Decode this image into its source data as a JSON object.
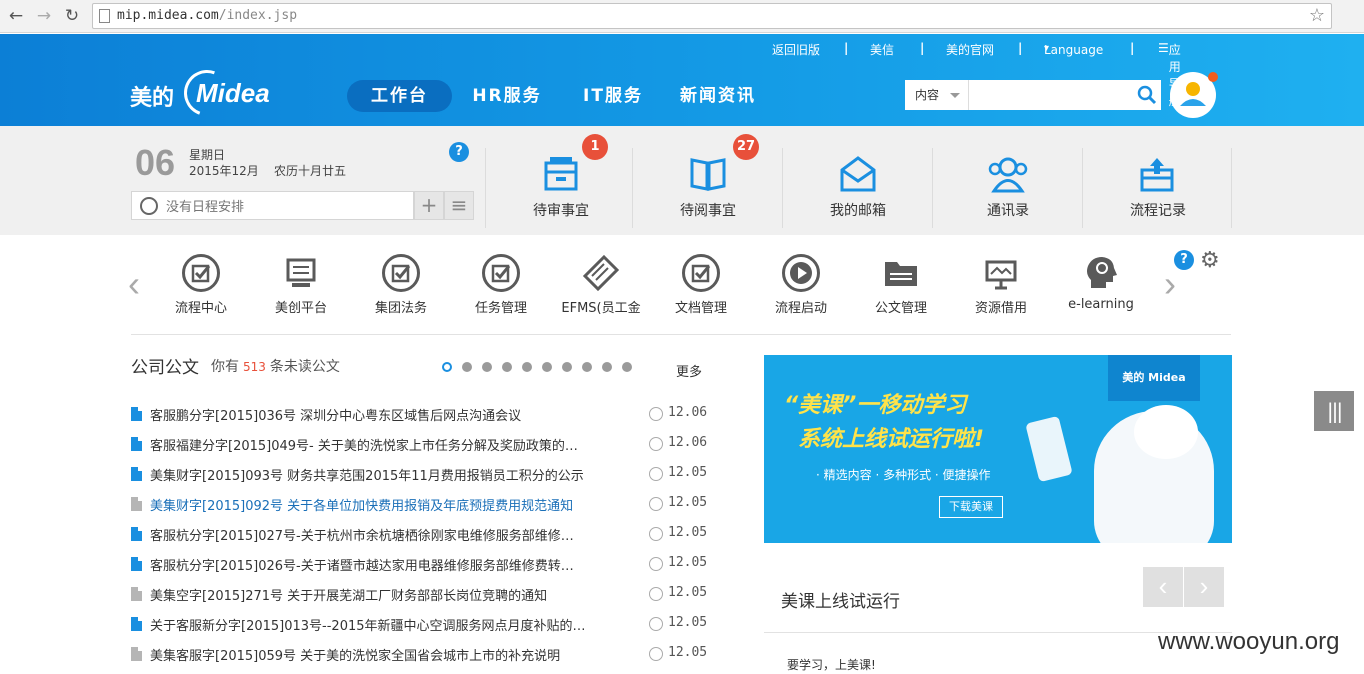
{
  "browser": {
    "url_host": "mip.midea.com",
    "url_path": "/index.jsp"
  },
  "header": {
    "top_links": [
      "返回旧版",
      "美信",
      "美的官网",
      "Language",
      "应用导航"
    ],
    "logo_cn": "美的",
    "logo_en": "Midea",
    "nav": [
      "工作台",
      "HR服务",
      "IT服务",
      "新闻资讯"
    ],
    "search_type": "内容",
    "search_placeholder": ""
  },
  "calendar": {
    "day": "06",
    "weekday": "星期日",
    "year_month": "2015年12月",
    "lunar": "农历十月廿五",
    "schedule_placeholder": "没有日程安排",
    "add_label": "+",
    "list_label": "≡"
  },
  "quick_links": [
    {
      "label": "待审事宜",
      "badge": "1"
    },
    {
      "label": "待阅事宜",
      "badge": "27"
    },
    {
      "label": "我的邮箱"
    },
    {
      "label": "通讯录"
    },
    {
      "label": "流程记录"
    }
  ],
  "apps": [
    "流程中心",
    "美创平台",
    "集团法务",
    "任务管理",
    "EFMS(员工金",
    "文档管理",
    "流程启动",
    "公文管理",
    "资源借用",
    "e-learning"
  ],
  "notices": {
    "title": "公司公文",
    "prefix": "你有",
    "count": "513",
    "suffix": "条未读公文",
    "more": "更多",
    "items": [
      {
        "title": "客服鹏分字[2015]036号 深圳分中心粤东区域售后网点沟通会议",
        "date": "12.06",
        "unread": true,
        "hl": false
      },
      {
        "title": "客服福建分字[2015]049号- 关于美的洗悦家上市任务分解及奖励政策的…",
        "date": "12.06",
        "unread": true,
        "hl": false
      },
      {
        "title": "美集财字[2015]093号 财务共享范围2015年11月费用报销员工积分的公示",
        "date": "12.05",
        "unread": true,
        "hl": false
      },
      {
        "title": "美集财字[2015]092号 关于各单位加快费用报销及年底预提费用规范通知",
        "date": "12.05",
        "unread": false,
        "hl": true
      },
      {
        "title": "客服杭分字[2015]027号-关于杭州市余杭塘栖徐刚家电维修服务部维修…",
        "date": "12.05",
        "unread": true,
        "hl": false
      },
      {
        "title": "客服杭分字[2015]026号-关于诸暨市越达家用电器维修服务部维修费转…",
        "date": "12.05",
        "unread": true,
        "hl": false
      },
      {
        "title": "美集空字[2015]271号 关于开展芜湖工厂财务部部长岗位竞聘的通知",
        "date": "12.05",
        "unread": false,
        "hl": false
      },
      {
        "title": "关于客服新分字[2015]013号--2015年新疆中心空调服务网点月度补贴的…",
        "date": "12.05",
        "unread": true,
        "hl": false
      },
      {
        "title": "美集客服字[2015]059号 关于美的洗悦家全国省会城市上市的补充说明",
        "date": "12.05",
        "unread": false,
        "hl": false
      }
    ]
  },
  "banner": {
    "brand": "美的 Midea",
    "line1": "“美课”一移动学习",
    "line2": "系统上线试运行啦!",
    "sub": "· 精选内容  · 多种形式  · 便捷操作",
    "download": "下载美课"
  },
  "promo": {
    "title": "美课上线试运行",
    "text": "要学习，上美课!"
  },
  "watermark": "www.wooyun.org",
  "colors": {
    "brand_blue": "#149be6",
    "accent_red": "#e8503a"
  }
}
